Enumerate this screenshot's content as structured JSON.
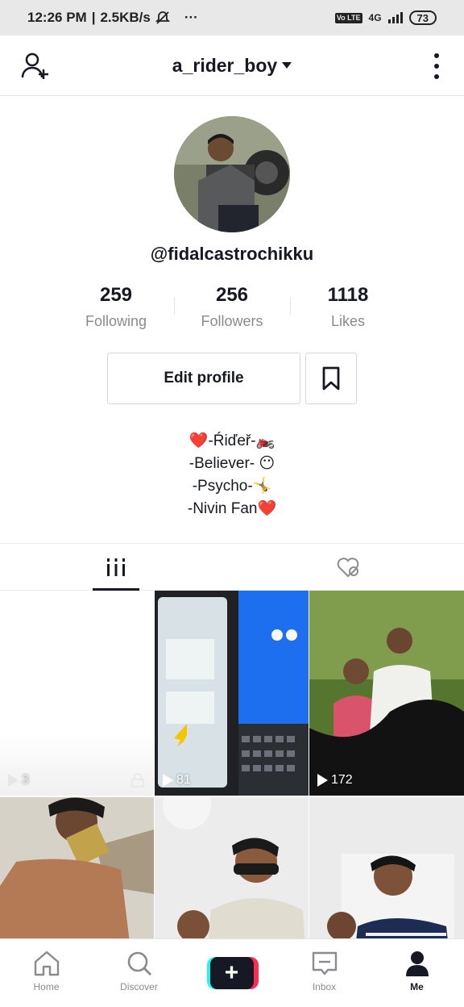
{
  "status_bar": {
    "time": "12:26 PM",
    "network_speed": "2.5KB/s",
    "dots": "···",
    "volte": "Vo LTE",
    "network_type": "4G",
    "battery": "73"
  },
  "header": {
    "username": "a_rider_boy"
  },
  "profile": {
    "handle": "@fidalcastrochikku",
    "stats": [
      {
        "value": "259",
        "label": "Following"
      },
      {
        "value": "256",
        "label": "Followers"
      },
      {
        "value": "1118",
        "label": "Likes"
      }
    ],
    "edit_label": "Edit profile",
    "bio": [
      "❤️-Ŕiďeř-🏍️",
      "-Believer- 😶",
      "-Psycho-🤸",
      "-Nivin Fan❤️"
    ]
  },
  "videos": [
    {
      "views": "3"
    },
    {
      "views": "81"
    },
    {
      "views": "172"
    },
    {
      "views": ""
    },
    {
      "views": ""
    },
    {
      "views": ""
    }
  ],
  "bottom_nav": {
    "home": "Home",
    "discover": "Discover",
    "create": "+",
    "inbox": "Inbox",
    "me": "Me"
  }
}
